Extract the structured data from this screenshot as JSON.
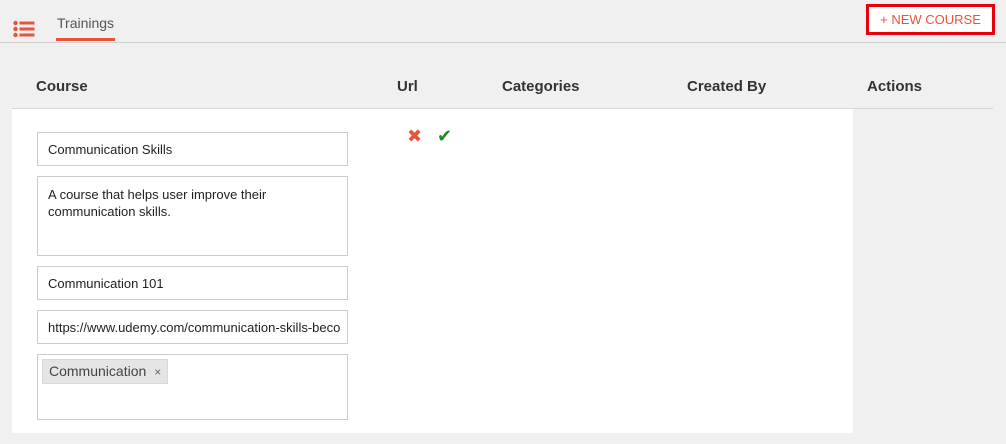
{
  "header": {
    "tab_label": "Trainings",
    "new_course_label": "+ NEW COURSE",
    "menu_icon": "list-icon"
  },
  "table": {
    "columns": [
      "Course",
      "Url",
      "Categories",
      "Created By",
      "Actions"
    ]
  },
  "form": {
    "name_value": "Communication Skills",
    "description_value": "A course that helps user improve their communication skills.",
    "code_value": "Communication 101",
    "url_value": "https://www.udemy.com/communication-skills-beco",
    "tags": [
      {
        "label": "Communication",
        "remove": "×"
      }
    ]
  },
  "actions": {
    "cancel_icon": "✖",
    "confirm_icon": "✔"
  },
  "colors": {
    "accent": "#e8543a",
    "highlight_border": "#e8000d",
    "confirm": "#1e8a1e"
  }
}
